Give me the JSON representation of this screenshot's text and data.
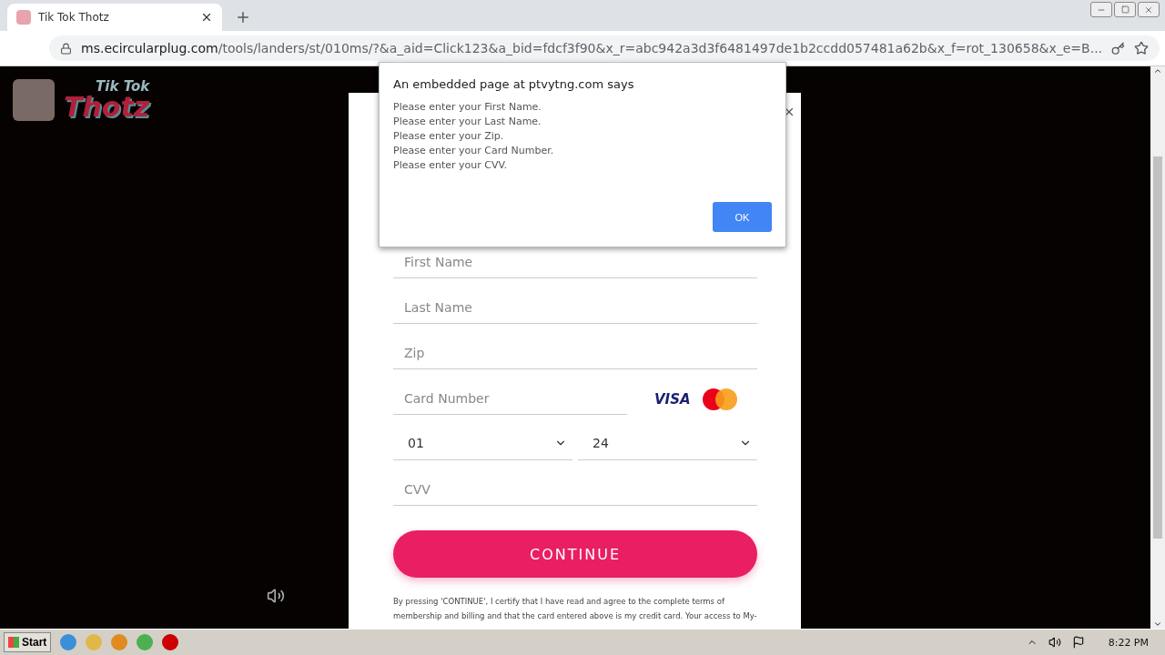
{
  "browser": {
    "tab": {
      "title": "Tik Tok Thotz",
      "selected": true
    },
    "url": {
      "host": "ms.ecircularplug.com",
      "path": "/tools/landers/st/010ms/?&a_aid=Click123&a_bid=fdcf3f90&x_r=abc942a3d3f6481497de1b2ccdd057481a62b&x_f=rot_130658&x_e=B..."
    }
  },
  "logo": {
    "line_1": "Tik Tok",
    "line_2": "Thotz"
  },
  "form": {
    "fields": [
      {
        "kind": "text",
        "placeholder": "First Name"
      },
      {
        "kind": "text",
        "placeholder": "Last Name"
      },
      {
        "kind": "text",
        "placeholder": "Zip"
      },
      {
        "kind": "card",
        "placeholder": "Card Number",
        "brand": "VISA"
      },
      {
        "kind": "expiry",
        "month": "01",
        "year": "24"
      },
      {
        "kind": "text",
        "placeholder": "CVV"
      }
    ],
    "button": "CONTINUE",
    "terms": "By pressing 'CONTINUE', I certify that I have read and agree to the complete terms of membership and billing and that the card entered above is my credit card. Your access to My-"
  },
  "dialog": {
    "title": "An embedded page at ptvytng.com says",
    "lines": [
      "Please enter your First Name.",
      "Please enter your Last Name.",
      "Please enter your Zip.",
      "Please enter your Card Number.",
      "Please enter your CVV."
    ],
    "button": "OK"
  },
  "taskbar": {
    "start": "Start",
    "time": "8:22 PM"
  }
}
